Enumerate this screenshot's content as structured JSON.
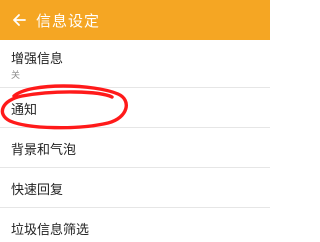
{
  "header": {
    "title": "信息设定",
    "back_icon": "arrow-left-icon",
    "bg_color": "#f5a623"
  },
  "items": [
    {
      "label": "增强信息",
      "sub": "关"
    },
    {
      "label": "通知"
    },
    {
      "label": "背景和气泡"
    },
    {
      "label": "快速回复"
    },
    {
      "label": "垃圾信息筛选"
    }
  ],
  "annotation": {
    "color": "#ff1a1a",
    "target": "通知"
  }
}
